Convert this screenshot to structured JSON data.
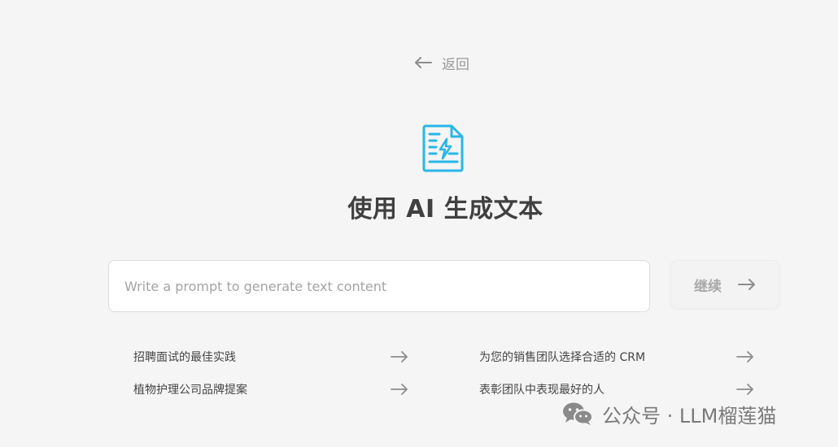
{
  "back": {
    "label": "返回"
  },
  "hero": {
    "title": "使用 AI 生成文本"
  },
  "prompt": {
    "placeholder": "Write a prompt to generate text content",
    "value": ""
  },
  "continue_button": {
    "label": "继续"
  },
  "suggestions": [
    {
      "label": "招聘面试的最佳实践"
    },
    {
      "label": "为您的销售团队选择合适的 CRM"
    },
    {
      "label": "植物护理公司品牌提案"
    },
    {
      "label": "表彰团队中表现最好的人"
    }
  ],
  "watermark": {
    "text": "公众号 · LLM榴莲猫"
  },
  "icons": {
    "back": "arrow-left-icon",
    "hero": "document-lightning-icon",
    "continue": "arrow-right-icon",
    "suggestion": "arrow-right-icon",
    "watermark": "wechat-icon"
  },
  "colors": {
    "background": "#f5f5f5",
    "accent": "#29b6e8",
    "title": "#404040",
    "muted": "#9a9a9a"
  }
}
